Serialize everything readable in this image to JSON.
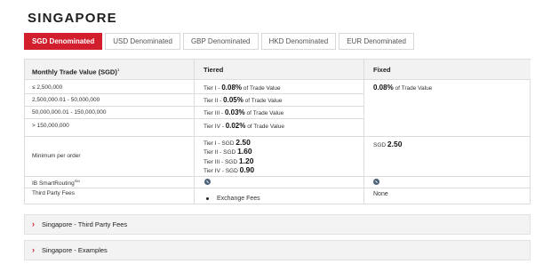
{
  "page": {
    "title": "SINGAPORE"
  },
  "tabs": [
    {
      "label": "SGD Denominated",
      "active": true
    },
    {
      "label": "USD Denominated",
      "active": false
    },
    {
      "label": "GBP Denominated",
      "active": false
    },
    {
      "label": "HKD Denominated",
      "active": false
    },
    {
      "label": "EUR Denominated",
      "active": false
    }
  ],
  "table": {
    "headers": {
      "col1": "Monthly Trade Value (SGD)",
      "col1_sup": "1",
      "col2": "Tiered",
      "col3": "Fixed"
    },
    "tiers": [
      {
        "range": "≤ 2,500,000",
        "tier": "Tier I -",
        "rate": "0.08%",
        "suffix": "of Trade Value"
      },
      {
        "range": "2,500,000.01 - 50,000,000",
        "tier": "Tier II -",
        "rate": "0.05%",
        "suffix": "of Trade Value"
      },
      {
        "range": "50,000,000.01 - 150,000,000",
        "tier": "Tier III -",
        "rate": "0.03%",
        "suffix": "of Trade Value"
      },
      {
        "range": "> 150,000,000",
        "tier": "Tier IV -",
        "rate": "0.02%",
        "suffix": "of Trade Value"
      }
    ],
    "fixed_rate": {
      "rate": "0.08%",
      "suffix": "of Trade Value"
    },
    "minimum": {
      "label": "Minimum per order",
      "tiers": [
        {
          "tier": "Tier I -",
          "currency": "SGD",
          "value": "2.50"
        },
        {
          "tier": "Tier II -",
          "currency": "SGD",
          "value": "1.60"
        },
        {
          "tier": "Tier III -",
          "currency": "SGD",
          "value": "1.20"
        },
        {
          "tier": "Tier IV -",
          "currency": "SGD",
          "value": "0.90"
        }
      ],
      "fixed": {
        "currency": "SGD",
        "value": "2.50"
      }
    },
    "smart_routing": {
      "label": "IB SmartRouting",
      "sup": "SM"
    },
    "third_party": {
      "label": "Third Party Fees",
      "tiered_item": "Exchange Fees",
      "fixed": "None"
    }
  },
  "accordions": [
    {
      "label": "Singapore - Third Party Fees"
    },
    {
      "label": "Singapore - Examples"
    }
  ],
  "colors": {
    "accent": "#d11f2e",
    "check_icon": "#4d6478",
    "header_bg": "#f2f2f2"
  }
}
